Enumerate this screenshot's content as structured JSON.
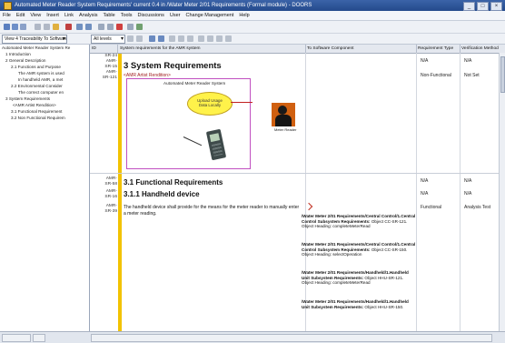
{
  "window": {
    "title": "Automated Meter Reader System Requirements' current 0.4 in /Water Meter 2/01 Requirements (Formal module) - DOORS",
    "buttons": [
      "_",
      "□",
      "×"
    ]
  },
  "menu": [
    "File",
    "Edit",
    "View",
    "Insert",
    "Link",
    "Analysis",
    "Table",
    "Tools",
    "Discussions",
    "User",
    "Change Management",
    "Help"
  ],
  "toolbar": {
    "view_combo": "View  4 Traceability To Software Co...",
    "level_combo": "All levels"
  },
  "tree": [
    "Automated Meter Reader System Re",
    "1 Introduction",
    "2 General Description",
    "2.1 Functions and Purpose",
    "The AMR system is used",
    "In handheld AMR, a met",
    "2.2 Environmental Consider",
    "The correct computer en",
    "3 System Requirements",
    "<AMR Artist Rendition>",
    "3.1 Functional Requirement",
    "3.2 Non Functional Requirem"
  ],
  "columns": {
    "id": "ID",
    "req": "System requirements for the AMR system",
    "sw": "To Software Component",
    "type": "Requirement Type",
    "verif": "Verification Method"
  },
  "rows": {
    "r1_ids": [
      "SR-24",
      "AMR-",
      "SR-15",
      "AMR-",
      "SR-121"
    ],
    "sys_heading": "3 System Requirements",
    "rendition_label": "<AMR Artist Rendition>",
    "diagram_title": "Automated Meter Reader System",
    "upload_bubble": "Upload Usage Data Locally",
    "meter_reader": "Meter Reader",
    "r1_type": "N/A",
    "r1_verif": "N/A",
    "r2_type": "Non-Functional",
    "r2_verif": "Not Set",
    "r3_ids": [
      "AMR-",
      "SR-58"
    ],
    "func_heading": "3.1 Functional Requirements",
    "r3_type": "N/A",
    "r3_verif": "N/A",
    "r4_ids": [
      "AMR-",
      "SR-16"
    ],
    "hh_heading": "3.1.1 Handheld device",
    "r4_type": "N/A",
    "r4_verif": "N/A",
    "r5_ids": [
      "AMR-",
      "SR-39"
    ],
    "hh_body": "The handheld device shall provide for the means for the meter reader to manually enter a meter reading.",
    "r5_type": "Functional",
    "r5_verif": "Analysis Test"
  },
  "links": [
    {
      "bold": "/Water Meter 2/01 Requirements/Central Control/1.Central Control Subsystem Requirements:",
      "tail": " Object CC-SR-121.",
      "heading": "Object Heading: completeMeterRead"
    },
    {
      "bold": "/Water Meter 2/01 Requirements/Central Control/1.Central Control Subsystem Requirements:",
      "tail": " Object CC-SR-150.",
      "heading": "Object Heading: selectOperation"
    },
    {
      "bold": "/Water Meter 2/01 Requirements/Handheld/1.Handheld Unit Subsystem Requirements:",
      "tail": " Object HHU-SR-121.",
      "heading": "Object Heading: completeMeterRead"
    },
    {
      "bold": "/Water Meter 2/01 Requirements/Handheld/1.Handheld Unit Subsystem Requirements:",
      "tail": " Object HHU-SR-150.",
      "heading": ""
    }
  ],
  "colors": {
    "accent_bar": "#f2c200",
    "diagram_border": "#c050c0",
    "bubble_fill": "#fff24a"
  }
}
